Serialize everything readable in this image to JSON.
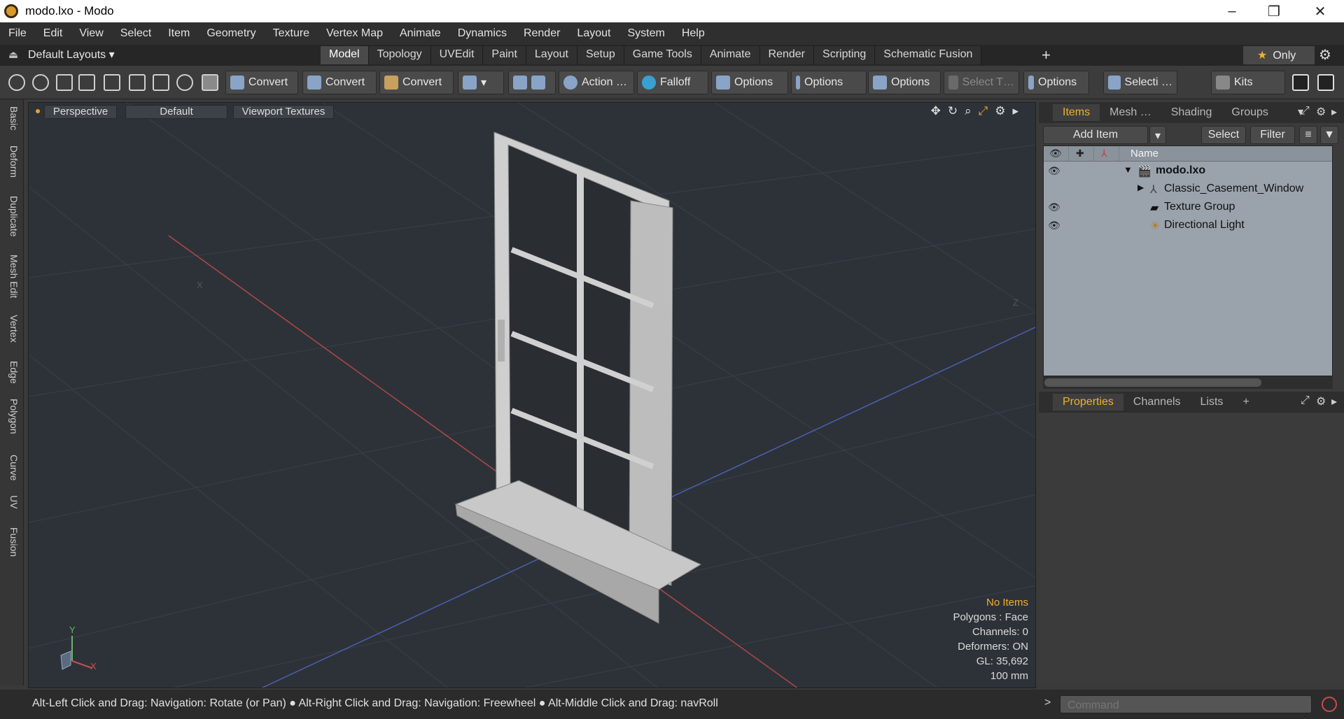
{
  "window": {
    "title": "modo.lxo - Modo",
    "minimize": "–",
    "restore": "❐",
    "close": "✕"
  },
  "menu": [
    "File",
    "Edit",
    "View",
    "Select",
    "Item",
    "Geometry",
    "Texture",
    "Vertex Map",
    "Animate",
    "Dynamics",
    "Render",
    "Layout",
    "System",
    "Help"
  ],
  "layoutbar": {
    "layouts_label": "Default Layouts ▾",
    "tabs": [
      "Model",
      "Topology",
      "UVEdit",
      "Paint",
      "Layout",
      "Setup",
      "Game Tools",
      "Animate",
      "Render",
      "Scripting",
      "Schematic Fusion"
    ],
    "active_tab": "Model",
    "plus": "+",
    "only_star": "★",
    "only_label": "Only"
  },
  "toolbar": {
    "convert1": "Convert",
    "convert2": "Convert",
    "convert3": "Convert",
    "action": "Action",
    "action_more": "…",
    "falloff": "Falloff",
    "options1": "Options",
    "options2": "Options",
    "options3": "Options",
    "select_t": "Select T…",
    "options4": "Options",
    "selecti": "Selecti …",
    "kits": "Kits"
  },
  "left_tabs": [
    "Basic",
    "Deform",
    "Duplicate",
    "Mesh Edit",
    "Vertex",
    "Edge",
    "Polygon",
    "Curve",
    "UV",
    "Fusion"
  ],
  "viewport": {
    "view": "Perspective",
    "shading": "Default",
    "textures": "Viewport Textures",
    "info": {
      "no_items": "No Items",
      "polygons": "Polygons : Face",
      "channels": "Channels: 0",
      "deformers": "Deformers: ON",
      "gl": "GL: 35,692",
      "scale": "100 mm"
    },
    "axis_y": "Y",
    "axis_x": "X",
    "axis_z": "Z",
    "axis_x2": "X"
  },
  "items_panel": {
    "tabs": [
      "Items",
      "Mesh …",
      "Shading",
      "Groups"
    ],
    "active_tab": "Items",
    "add_item": "Add Item",
    "select": "Select",
    "filter": "Filter",
    "col_name": "Name",
    "tree": [
      {
        "label": "modo.lxo",
        "bold": true,
        "eye": true
      },
      {
        "label": "Classic_Casement_Window",
        "eye": false
      },
      {
        "label": "Texture Group",
        "eye": true
      },
      {
        "label": "Directional Light",
        "eye": true
      }
    ]
  },
  "props_panel": {
    "tabs": [
      "Properties",
      "Channels",
      "Lists"
    ],
    "active_tab": "Properties",
    "plus": "+"
  },
  "status": {
    "hint1": "Alt-Left Click and Drag: Navigation: Rotate (or Pan)",
    "hint2": "Alt-Right Click and Drag: Navigation: Freewheel",
    "hint3": "Alt-Middle Click and Drag: navRoll",
    "command_placeholder": "Command",
    "prompt": ">"
  }
}
